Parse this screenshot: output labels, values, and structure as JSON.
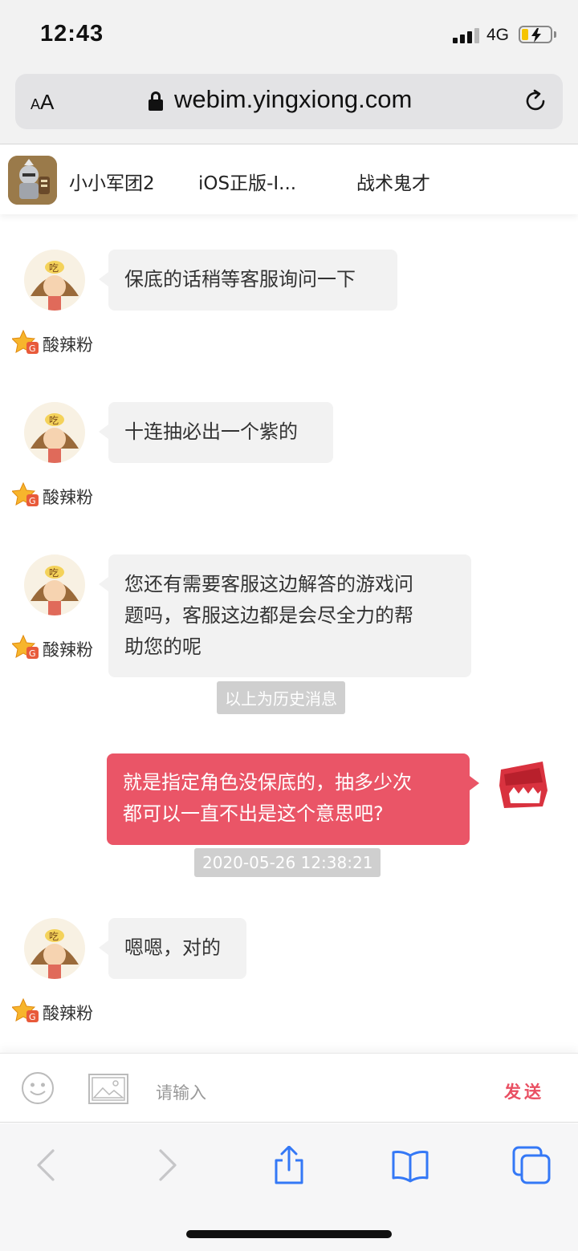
{
  "status_bar": {
    "time": "12:43",
    "network": "4G"
  },
  "browser": {
    "text_size_label_small": "A",
    "text_size_label_large": "A",
    "url": "webim.yingxiong.com"
  },
  "chat_header": {
    "game_name": "小小军团2",
    "platform": "iOS正版-I...",
    "agent_name": "战术鬼才"
  },
  "messages": [
    {
      "side": "left",
      "text": "保底的话稍等客服询问一下",
      "sender": "酸辣粉"
    },
    {
      "side": "left",
      "text": "十连抽必出一个紫的",
      "sender": "酸辣粉"
    },
    {
      "side": "left",
      "lines": [
        "您还有需要客服这边解答的游戏问",
        "题吗，客服这边都是会尽全力的帮",
        "助您的呢"
      ],
      "sender": "酸辣粉"
    },
    {
      "system": "以上为历史消息"
    },
    {
      "side": "right",
      "lines": [
        "就是指定角色没保底的，抽多少次",
        "都可以一直不出是这个意思吧?"
      ]
    },
    {
      "timestamp": "2020-05-26 12:38:21"
    },
    {
      "side": "left",
      "text": "嗯嗯，对的",
      "sender": "酸辣粉"
    }
  ],
  "input": {
    "placeholder": "请输入",
    "send_label": "发送"
  },
  "icons": [
    "emoji-icon",
    "image-icon",
    "back-icon",
    "forward-icon",
    "share-icon",
    "bookmarks-icon",
    "tabs-icon",
    "lock-icon",
    "reload-icon"
  ],
  "colors": {
    "accent": "#ea5567",
    "send": "#e94f62",
    "safari_blue": "#3478f6"
  }
}
